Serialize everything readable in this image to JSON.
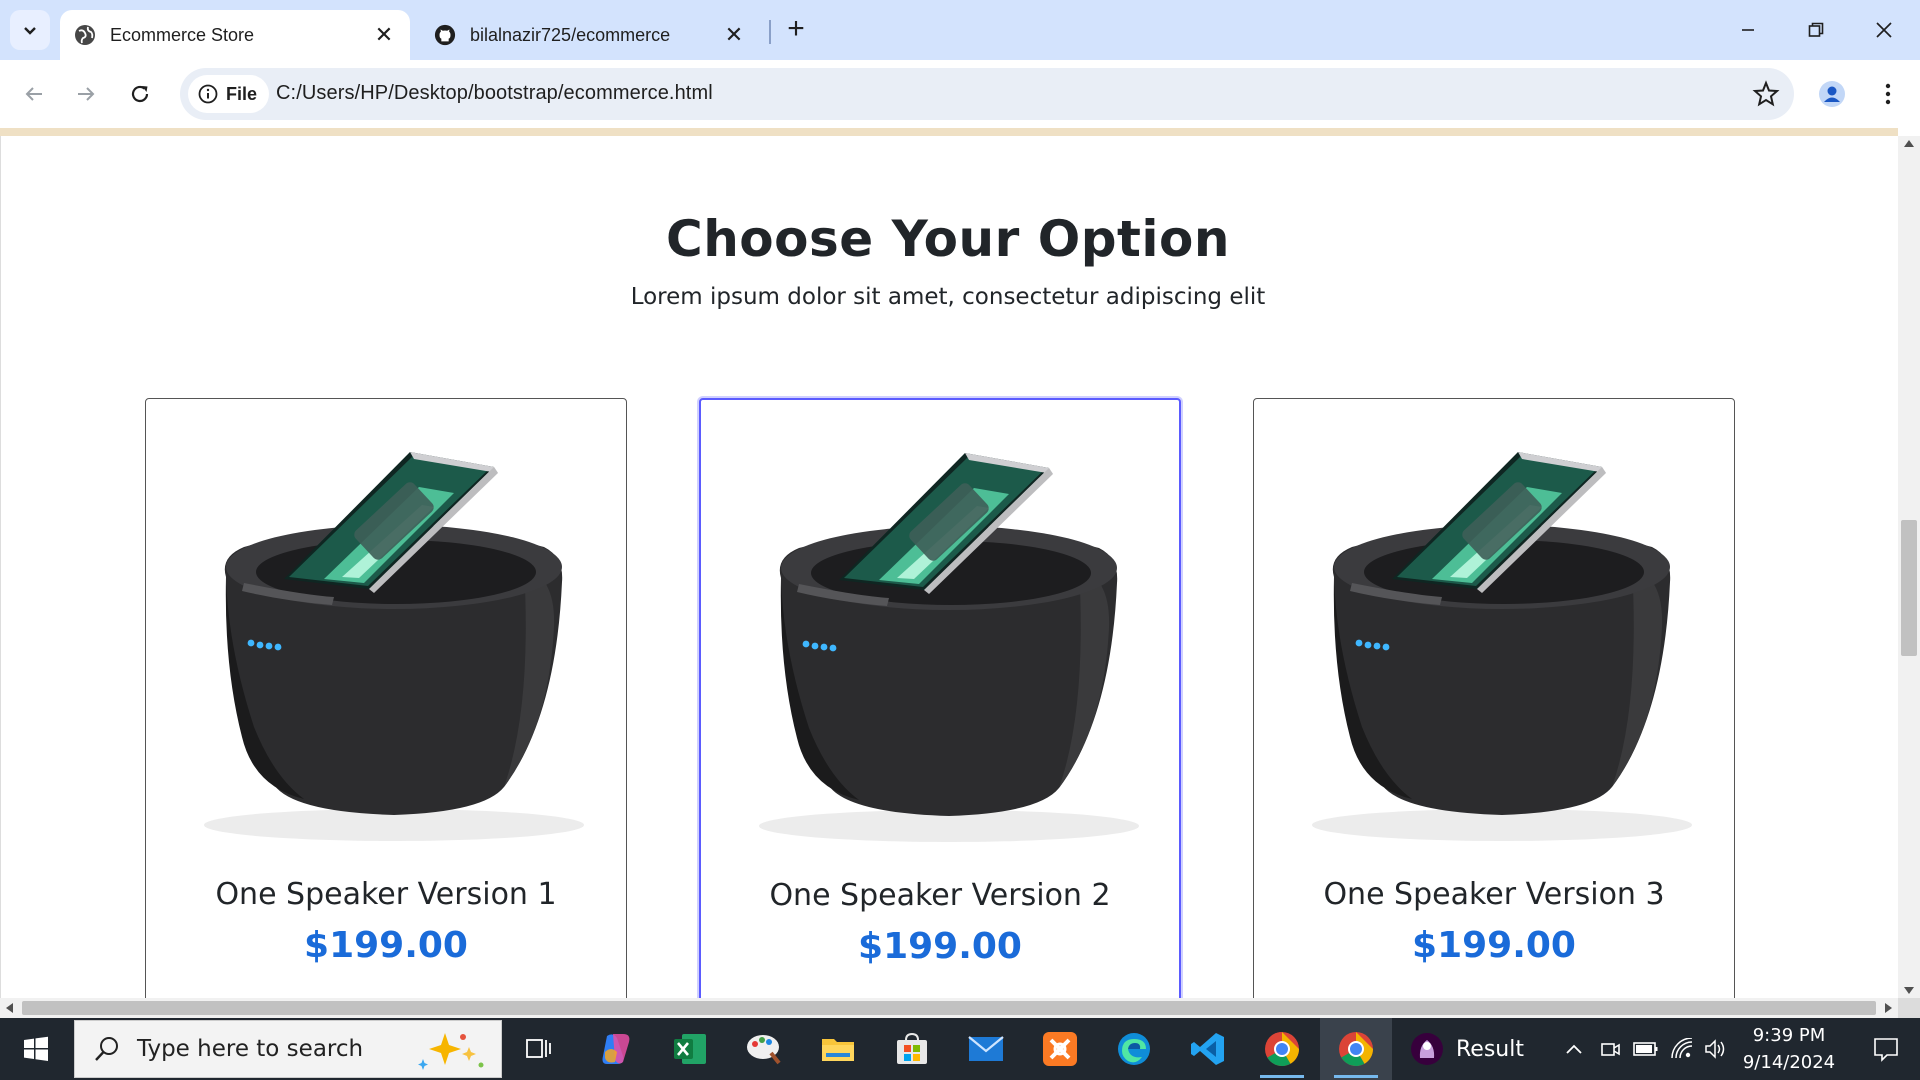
{
  "browser": {
    "tabs": [
      {
        "title": "Ecommerce Store",
        "active": true
      },
      {
        "title": "bilalnazir725/ecommerce",
        "active": false
      }
    ],
    "site_chip_label": "File",
    "url": "C:/Users/HP/Desktop/bootstrap/ecommerce.html"
  },
  "page": {
    "heading": "Choose Your Option",
    "subheading": "Lorem ipsum dolor sit amet, consectetur adipiscing elit",
    "products": [
      {
        "name": "One Speaker Version 1",
        "price": "$199.00"
      },
      {
        "name": "One Speaker Version 2",
        "price": "$199.00"
      },
      {
        "name": "One Speaker Version 3",
        "price": "$199.00"
      }
    ],
    "price_color": "#1a6bd9"
  },
  "taskbar": {
    "search_placeholder": "Type here to search",
    "pinned_apps": [
      "copilot-icon",
      "excel-icon",
      "paint-icon",
      "file-explorer-icon",
      "microsoft-store-icon",
      "mail-icon",
      "xampp-icon",
      "edge-icon",
      "vscode-icon",
      "chrome-icon",
      "chrome-icon"
    ],
    "result_label": "Result",
    "time": "9:39 PM",
    "date": "9/14/2024"
  }
}
